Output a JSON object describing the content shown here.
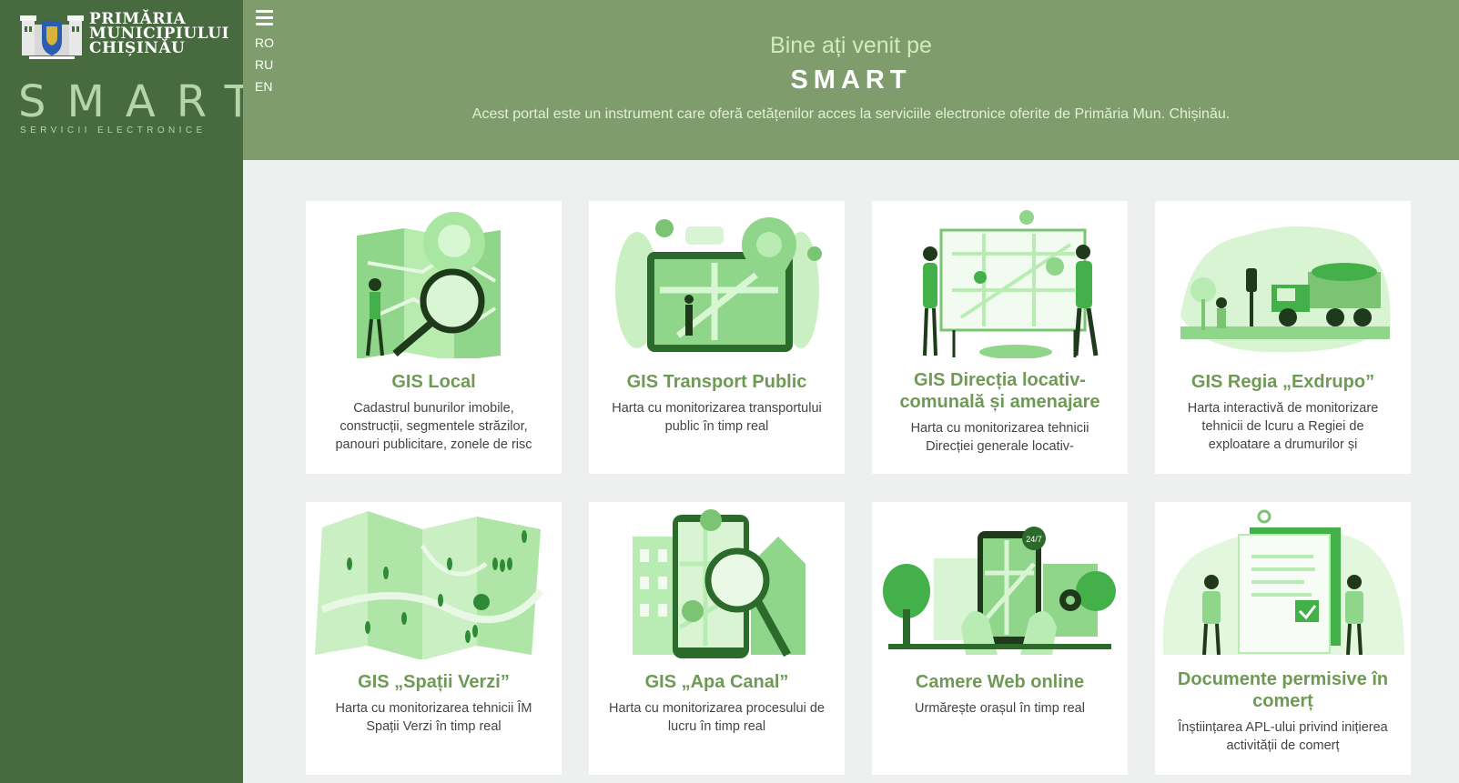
{
  "sidebar": {
    "org_name": [
      "PRIMĂRIA",
      "MUNICIPIULUI",
      "CHIȘINĂU"
    ],
    "brand": "SMART",
    "brand_sub": "SERVICII ELECTRONICE"
  },
  "header": {
    "languages": [
      "RO",
      "RU",
      "EN"
    ],
    "welcome": "Bine ați venit pe",
    "title": "SMART",
    "intro": "Acest portal este un instrument care oferă cetățenilor acces la serviciile electronice oferite de Primăria Mun. Chișinău."
  },
  "colors": {
    "sidebar": "#476a3f",
    "header": "#7f9c6d",
    "accent": "#6f9a55",
    "background": "#eef0ef"
  },
  "cards": [
    {
      "title": "GIS Local",
      "desc": "Cadastrul bunurilor imobile, construcții, segmentele străzilor, panouri publicitare, zonele de risc",
      "icon": "map-magnifier-illustration"
    },
    {
      "title": "GIS Transport Public",
      "desc": "Harta cu monitorizarea transportului public în timp real",
      "icon": "transport-map-illustration"
    },
    {
      "title": "GIS Direcția locativ-comunală și amenajare",
      "desc": "Harta cu monitorizarea tehnicii Direcției generale locativ-",
      "icon": "city-map-people-illustration"
    },
    {
      "title": "GIS Regia „Exdrupo”",
      "desc": "Harta interactivă de monitorizare tehnicii de lcuru a Regiei de exploatare a drumurilor și",
      "icon": "road-truck-illustration"
    },
    {
      "title": "GIS „Spații Verzi”",
      "desc": "Harta cu monitorizarea tehnicii ÎM Spații Verzi în timp real",
      "icon": "green-map-illustration"
    },
    {
      "title": "GIS „Apa Canal”",
      "desc": "Harta cu monitorizarea procesului de lucru în timp real",
      "icon": "phone-map-illustration"
    },
    {
      "title": "Camere Web online",
      "desc": "Urmărește orașul în timp real",
      "icon": "webcam-city-illustration"
    },
    {
      "title": "Documente permisive în comerț",
      "desc": "Înștiințarea APL-ului privind inițierea activității de comerț",
      "icon": "documents-illustration"
    }
  ]
}
